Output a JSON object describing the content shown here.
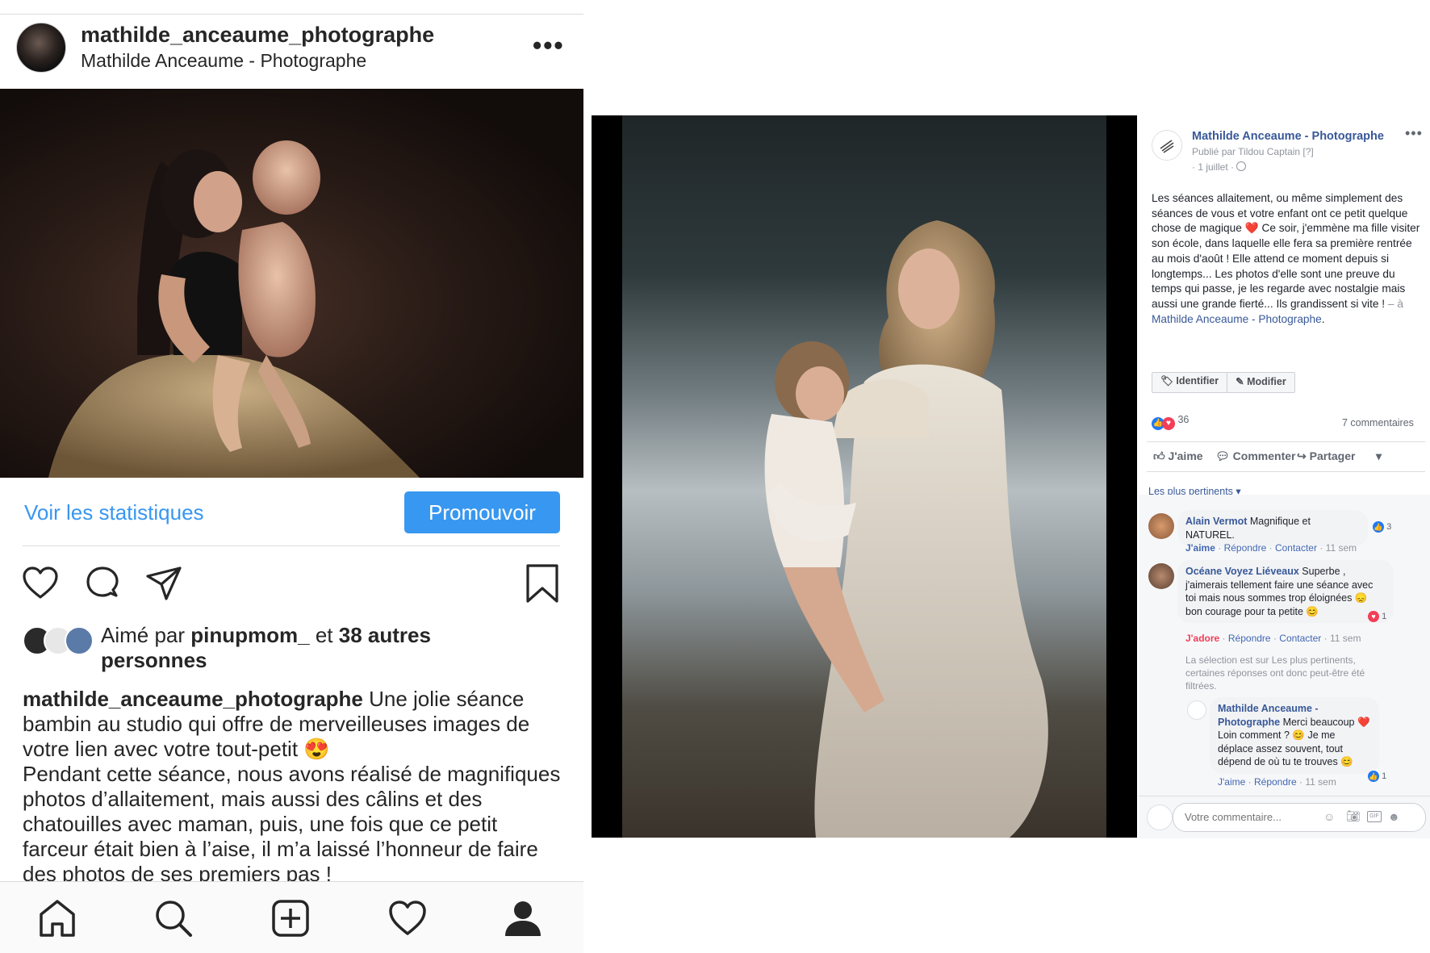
{
  "instagram": {
    "username": "mathilde_anceaume_photographe",
    "display_name": "Mathilde Anceaume - Photographe",
    "more_label": "•••",
    "stats_link": "Voir les statistiques",
    "promote_button": "Promouvoir",
    "likes_prefix": "Aimé par ",
    "likes_user": "pinupmom_",
    "likes_middle": " et ",
    "likes_others": "38 autres personnes",
    "caption_user": "mathilde_anceaume_photographe",
    "caption_text": " Une jolie séance bambin au studio qui offre de merveilleuses images de votre lien avec votre tout-petit 😍",
    "caption_text_2": "Pendant cette séance, nous avons réalisé de magnifiques photos d’allaitement, mais aussi des câlins et des chatouilles avec maman, puis, une fois que ce petit farceur était bien à l’aise, il m’a laissé l’honneur de faire des photos de ses premiers pas !"
  },
  "facebook": {
    "page_name": "Mathilde Anceaume - Photographe",
    "published_by": "Publié par Tildou Captain [?]",
    "date": "· 1 juillet ·",
    "more_label": "•••",
    "post_text": "Les séances allaitement, ou même simplement des séances de vous et votre enfant ont ce petit quelque chose de magique ❤️ Ce soir, j'emmène ma fille visiter son école, dans laquelle elle fera sa première rentrée au mois d'août ! Elle attend ce moment depuis si longtemps... Les photos d'elle sont une preuve du temps qui passe, je les regarde avec nostalgie mais aussi une grande fierté... Ils grandissent si vite !",
    "post_suffix": " – à ",
    "post_link": "Mathilde Anceaume - Photographe",
    "post_end": ".",
    "tag_button": "Identifier",
    "edit_button": "Modifier",
    "reaction_count": "36",
    "comment_count": "7 commentaires",
    "actions": {
      "like": "J'aime",
      "comment": "Commenter",
      "share": "Partager"
    },
    "sort_label": "Les plus pertinents ▾",
    "comments": [
      {
        "author": "Alain Vermot",
        "text": " Magnifique et NATUREL.",
        "reaction_count": "3",
        "like": "J'aime",
        "reply": "Répondre",
        "contact": "Contacter",
        "time": "11 sem"
      },
      {
        "author": "Océane Voyez Liéveaux",
        "text": " Superbe , j'aimerais tellement faire une séance avec toi mais nous sommes trop éloignées 😞 bon courage pour ta petite 😊",
        "reaction_count": "1",
        "like": "J'adore",
        "reply": "Répondre",
        "contact": "Contacter",
        "time": "11 sem"
      }
    ],
    "filter_note": "La sélection est sur Les plus pertinents, certaines réponses ont donc peut-être été filtrées.",
    "reply": {
      "author": "Mathilde Anceaume - Photographe",
      "text": " Merci beaucoup ❤️ Loin comment ? 😊 Je me déplace assez souvent, tout dépend de où tu te trouves 😊",
      "reaction_count": "1",
      "like": "J'aime",
      "reply": "Répondre",
      "time": "11 sem"
    },
    "comment_placeholder": "Votre commentaire..."
  },
  "colors": {
    "ig_blue": "#3897f0",
    "fb_blue": "#385898",
    "fb_love": "#f33e58"
  }
}
